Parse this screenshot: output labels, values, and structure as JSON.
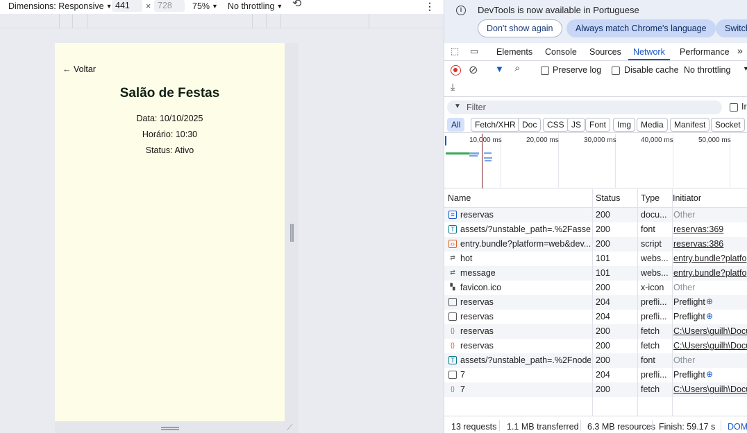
{
  "device_toolbar": {
    "dimensions_label": "Dimensions: Responsive",
    "width": "441",
    "times": "×",
    "height": "728",
    "zoom": "75%",
    "throttling": "No throttling"
  },
  "page": {
    "back_link": "← Voltar",
    "title": "Salão de Festas",
    "date_line": "Data: 10/10/2025",
    "time_line": "Horário: 10:30",
    "status_line": "Status: Ativo"
  },
  "infobar": {
    "message": "DevTools is now available in Portuguese",
    "dont_show": "Don't show again",
    "always_match": "Always match Chrome's language",
    "switch": "Switch"
  },
  "tabs": [
    "Elements",
    "Console",
    "Sources",
    "Network",
    "Performance"
  ],
  "active_tab": "Network",
  "network_toolbar": {
    "preserve_log": "Preserve log",
    "disable_cache": "Disable cache",
    "throttling": "No throttling"
  },
  "filter": {
    "placeholder": "Filter",
    "invert_cut": "Ir"
  },
  "type_filters": [
    "All",
    "Fetch/XHR",
    "Doc",
    "CSS",
    "JS",
    "Font",
    "Img",
    "Media",
    "Manifest",
    "Socket"
  ],
  "timeline_labels": [
    "10,000 ms",
    "20,000 ms",
    "30,000 ms",
    "40,000 ms",
    "50,000 ms"
  ],
  "table": {
    "headers": [
      "Name",
      "Status",
      "Type",
      "Initiator"
    ],
    "rows": [
      {
        "icon": "document-icon",
        "name": "reservas",
        "status": "200",
        "type": "docu...",
        "initiator": "Other",
        "initiator_style": "muted"
      },
      {
        "icon": "font-icon",
        "name": "assets/?unstable_path=.%2Fasset...",
        "status": "200",
        "type": "font",
        "initiator": "reservas:369",
        "initiator_style": "link"
      },
      {
        "icon": "script-icon",
        "name": "entry.bundle?platform=web&dev...",
        "status": "200",
        "type": "script",
        "initiator": "reservas:386",
        "initiator_style": "link"
      },
      {
        "icon": "websocket-icon",
        "name": "hot",
        "status": "101",
        "type": "webs...",
        "initiator": "entry.bundle?platfo",
        "initiator_style": "link"
      },
      {
        "icon": "websocket-icon",
        "name": "message",
        "status": "101",
        "type": "webs...",
        "initiator": "entry.bundle?platfo",
        "initiator_style": "link"
      },
      {
        "icon": "favicon-icon",
        "name": "favicon.ico",
        "status": "200",
        "type": "x-icon",
        "initiator": "Other",
        "initiator_style": "muted"
      },
      {
        "icon": "preflight-icon",
        "name": "reservas",
        "status": "204",
        "type": "prefli...",
        "initiator": "Preflight",
        "initiator_style": "preflight"
      },
      {
        "icon": "preflight-icon",
        "name": "reservas",
        "status": "204",
        "type": "prefli...",
        "initiator": "Preflight",
        "initiator_style": "preflight"
      },
      {
        "icon": "fetch-icon",
        "name": "reservas",
        "status": "200",
        "type": "fetch",
        "initiator": "C:\\Users\\guilh\\Docu",
        "initiator_style": "link"
      },
      {
        "icon": "fetch-icon",
        "name": "reservas",
        "status": "200",
        "type": "fetch",
        "initiator": "C:\\Users\\guilh\\Docu",
        "initiator_style": "link"
      },
      {
        "icon": "font-icon",
        "name": "assets/?unstable_path=.%2Fnode...",
        "status": "200",
        "type": "font",
        "initiator": "Other",
        "initiator_style": "muted"
      },
      {
        "icon": "preflight-icon",
        "name": "7",
        "status": "204",
        "type": "prefli...",
        "initiator": "Preflight",
        "initiator_style": "preflight"
      },
      {
        "icon": "fetch-icon",
        "name": "7",
        "status": "200",
        "type": "fetch",
        "initiator": "C:\\Users\\guilh\\Docu",
        "initiator_style": "link"
      }
    ]
  },
  "statusbar": {
    "requests": "13 requests",
    "transferred": "1.1 MB transferred",
    "resources": "6.3 MB resources",
    "finish": "Finish: 59.17 s",
    "dom": "DOM"
  },
  "colors": {
    "accent": "#1a56c4",
    "record": "#d93025",
    "page_bg": "#fefee8"
  }
}
